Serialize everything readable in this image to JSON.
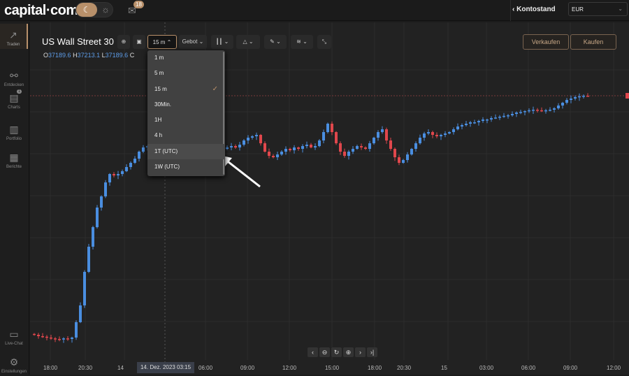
{
  "header": {
    "logo": "capital·com",
    "notifications": "18",
    "balance_label": "Kontostand",
    "currency": "EUR"
  },
  "sidebar": [
    {
      "label": "Traden",
      "icon": "trending-up-icon"
    },
    {
      "label": "Entdecken",
      "icon": "network-icon"
    },
    {
      "label": "Charts",
      "icon": "chart-monitor-icon",
      "badge": "1"
    },
    {
      "label": "Portfolio",
      "icon": "briefcase-icon"
    },
    {
      "label": "Berichte",
      "icon": "report-icon"
    },
    {
      "label": "Live-Chat",
      "icon": "chat-icon"
    },
    {
      "label": "Einstellungen",
      "icon": "gear-icon"
    }
  ],
  "instrument": {
    "name": "US Wall Street 30",
    "timeframe": "15 m",
    "price_type": "Gebot",
    "ohlc": {
      "o_label": "O",
      "o": "37189.6",
      "h_label": "H",
      "h": "37213.1",
      "l_label": "L",
      "l": "37189.6",
      "c_label": "C"
    }
  },
  "actions": {
    "sell": "Verkaufen",
    "buy": "Kaufen"
  },
  "timeframe_menu": {
    "items": [
      "1 m",
      "5 m",
      "15 m",
      "30Min.",
      "1H",
      "4 h",
      "1T (UTC)",
      "1W (UTC)"
    ],
    "selected": "15 m",
    "hovered": "1T (UTC)"
  },
  "time_axis": [
    "18:00",
    "20:30",
    "14",
    "06:00",
    "09:00",
    "12:00",
    "15:00",
    "18:00",
    "20:30",
    "15",
    "03:00",
    "06:00",
    "09:00",
    "12:00"
  ],
  "crosshair_time": "14. Dez. 2023   03:15",
  "colors": {
    "up": "#4a8ee0",
    "down": "#e0474c",
    "accent": "#b8906a"
  },
  "chart_data": {
    "type": "candlestick",
    "closes": [
      36335,
      36330,
      36328,
      36325,
      36322,
      36320,
      36318,
      36322,
      36320,
      36325,
      36380,
      36440,
      36560,
      36650,
      36720,
      36790,
      36830,
      36880,
      36910,
      36905,
      36910,
      36920,
      36935,
      36950,
      36965,
      36990,
      37005,
      37010,
      37020,
      37015,
      37010,
      37012,
      37005,
      37000,
      36995,
      37000,
      37005,
      37010,
      37015,
      37018,
      37020,
      37015,
      37010,
      37012,
      37005,
      37000,
      37005,
      37010,
      37005,
      37015,
      37030,
      37040,
      37045,
      37050,
      37020,
      36990,
      36975,
      36970,
      36980,
      36990,
      37000,
      36995,
      37005,
      37000,
      37010,
      37015,
      37005,
      37010,
      37030,
      37060,
      37090,
      37060,
      37020,
      36990,
      36975,
      36990,
      37000,
      37010,
      37005,
      37000,
      37020,
      37040,
      37060,
      37070,
      37030,
      37000,
      36970,
      36950,
      36960,
      36980,
      37000,
      37020,
      37040,
      37055,
      37060,
      37050,
      37045,
      37050,
      37055,
      37060,
      37070,
      37080,
      37085,
      37090,
      37095,
      37095,
      37100,
      37105,
      37105,
      37110,
      37112,
      37115,
      37118,
      37120,
      37125,
      37130,
      37132,
      37135,
      37138,
      37140,
      37138,
      37135,
      37138,
      37140,
      37145,
      37155,
      37165,
      37175,
      37180,
      37185,
      37188,
      37190,
      37189.6
    ]
  }
}
